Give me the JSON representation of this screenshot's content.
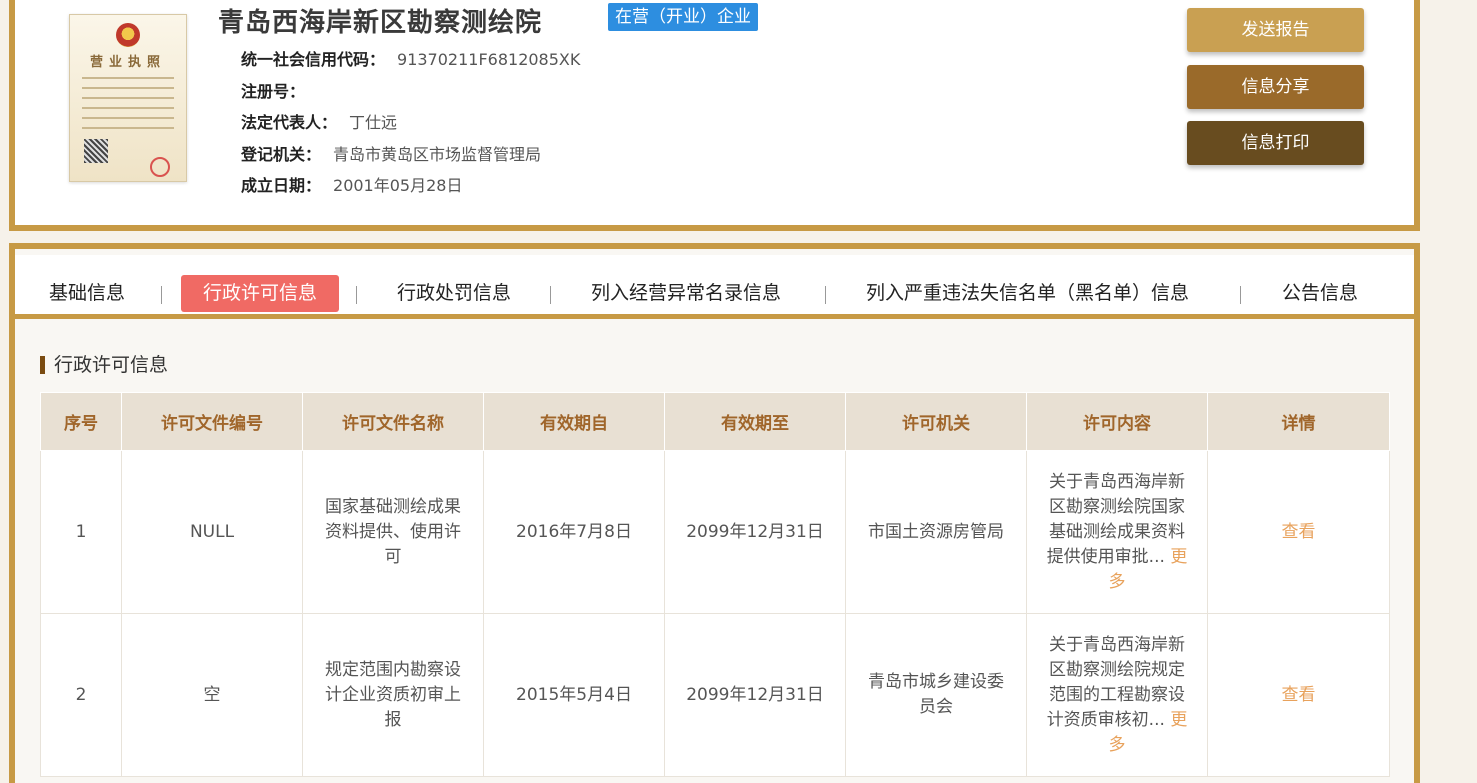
{
  "enterprise": {
    "name": "青岛西海岸新区勘察测绘院",
    "status": "在营（开业）企业",
    "license_title": "营业执照",
    "fields": [
      {
        "label": "统一社会信用代码：",
        "value": "91370211F6812085XK"
      },
      {
        "label": "注册号：",
        "value": ""
      },
      {
        "label": "法定代表人：",
        "value": "丁仕远"
      },
      {
        "label": "登记机关：",
        "value": "青岛市黄岛区市场监督管理局"
      },
      {
        "label": "成立日期：",
        "value": "2001年05月28日"
      }
    ]
  },
  "actions": {
    "send_report": "发送报告",
    "share_info": "信息分享",
    "print_info": "信息打印"
  },
  "tabs": [
    {
      "label": "基础信息",
      "active": false
    },
    {
      "label": "行政许可信息",
      "active": true
    },
    {
      "label": "行政处罚信息",
      "active": false
    },
    {
      "label": "列入经营异常名录信息",
      "active": false
    },
    {
      "label": "列入严重违法失信名单（黑名单）信息",
      "active": false
    },
    {
      "label": "公告信息",
      "active": false
    }
  ],
  "section": {
    "title": "行政许可信息"
  },
  "table": {
    "columns": [
      "序号",
      "许可文件编号",
      "许可文件名称",
      "有效期自",
      "有效期至",
      "许可机关",
      "许可内容",
      "详情"
    ],
    "rows": [
      {
        "index": "1",
        "doc_no": "NULL",
        "doc_name": "国家基础测绘成果资料提供、使用许可",
        "valid_from": "2016年7月8日",
        "valid_to": "2099年12月31日",
        "authority": "市国土资源房管局",
        "content": "关于青岛西海岸新区勘察测绘院国家基础测绘成果资料提供使用审批...",
        "more": "更多",
        "detail": "查看"
      },
      {
        "index": "2",
        "doc_no": "空",
        "doc_name": "规定范围内勘察设计企业资质初审上报",
        "valid_from": "2015年5月4日",
        "valid_to": "2099年12月31日",
        "authority": "青岛市城乡建设委员会",
        "content": "关于青岛西海岸新区勘察测绘院规定范围的工程勘察设计资质审核初...",
        "more": "更多",
        "detail": "查看"
      }
    ]
  },
  "colors": {
    "gold_border": "#c79a45",
    "status_blue": "#2d8ee0",
    "active_tab": "#f06a64",
    "header_text": "#a0662b",
    "link": "#e8a25c"
  }
}
